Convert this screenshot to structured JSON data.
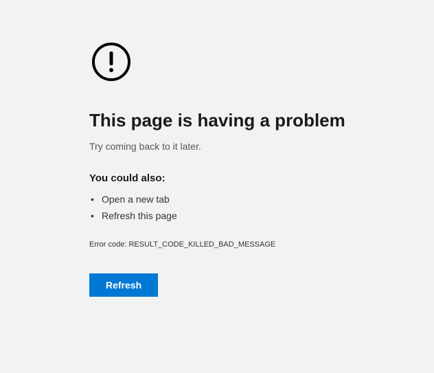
{
  "error": {
    "icon": "exclamation-circle",
    "heading": "This page is having a problem",
    "subtext": "Try coming back to it later.",
    "suggestions_heading": "You could also:",
    "suggestions": [
      "Open a new tab",
      "Refresh this page"
    ],
    "error_code_label": "Error code: ",
    "error_code_value": "RESULT_CODE_KILLED_BAD_MESSAGE",
    "refresh_button_label": "Refresh",
    "accent_color": "#0078d4"
  }
}
